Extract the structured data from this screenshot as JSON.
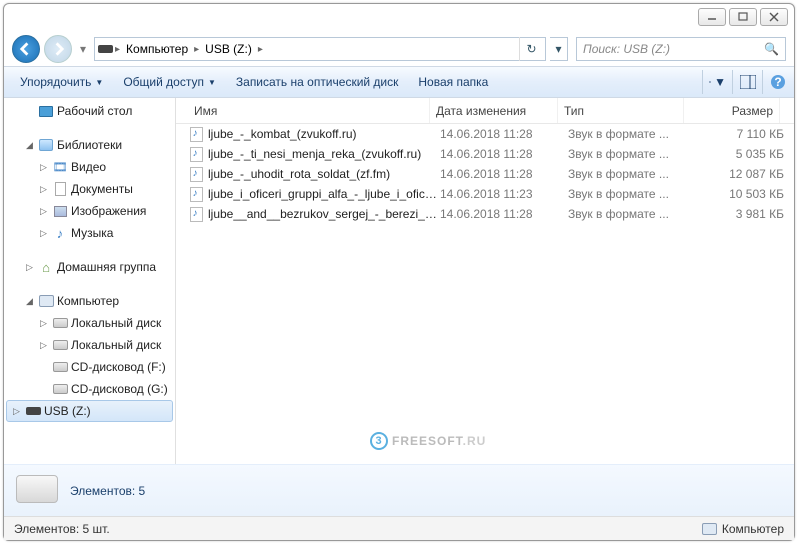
{
  "breadcrumb": {
    "seg1": "Компьютер",
    "seg2": "USB (Z:)"
  },
  "search": {
    "placeholder": "Поиск: USB (Z:)"
  },
  "toolbar": {
    "organize": "Упорядочить",
    "share": "Общий доступ",
    "burn": "Записать на оптический диск",
    "newfolder": "Новая папка"
  },
  "sidebar": {
    "desktop": "Рабочий стол",
    "libraries": "Библиотеки",
    "lib_video": "Видео",
    "lib_docs": "Документы",
    "lib_images": "Изображения",
    "lib_music": "Музыка",
    "homegroup": "Домашняя группа",
    "computer": "Компьютер",
    "localdisk1": "Локальный диск",
    "localdisk2": "Локальный диск",
    "cd_f": "CD-дисковод (F:)",
    "cd_g": "CD-дисковод (G:)",
    "usb": "USB (Z:)"
  },
  "columns": {
    "name": "Имя",
    "date": "Дата изменения",
    "type": "Тип",
    "size": "Размер"
  },
  "files": [
    {
      "name": "ljube_-_kombat_(zvukoff.ru)",
      "date": "14.06.2018 11:28",
      "type": "Звук в формате ...",
      "size": "7 110 КБ"
    },
    {
      "name": "ljube_-_ti_nesi_menja_reka_(zvukoff.ru)",
      "date": "14.06.2018 11:28",
      "type": "Звук в формате ...",
      "size": "5 035 КБ"
    },
    {
      "name": "ljube_-_uhodit_rota_soldat_(zf.fm)",
      "date": "14.06.2018 11:28",
      "type": "Звук в формате ...",
      "size": "12 087 КБ"
    },
    {
      "name": "ljube_i_oficeri_gruppi_alfa_-_ljube_i_ofice...",
      "date": "14.06.2018 11:23",
      "type": "Звук в формате ...",
      "size": "10 503 КБ"
    },
    {
      "name": "ljube__and__bezrukov_sergej_-_berezi_(zv...",
      "date": "14.06.2018 11:28",
      "type": "Звук в формате ...",
      "size": "3 981 КБ"
    }
  ],
  "details": {
    "label": "Элементов: 5"
  },
  "statusbar": {
    "left": "Элементов: 5 шт.",
    "right": "Компьютер"
  },
  "watermark": {
    "brand": "FREESOFT",
    "tld": ".RU",
    "badge": "3"
  }
}
